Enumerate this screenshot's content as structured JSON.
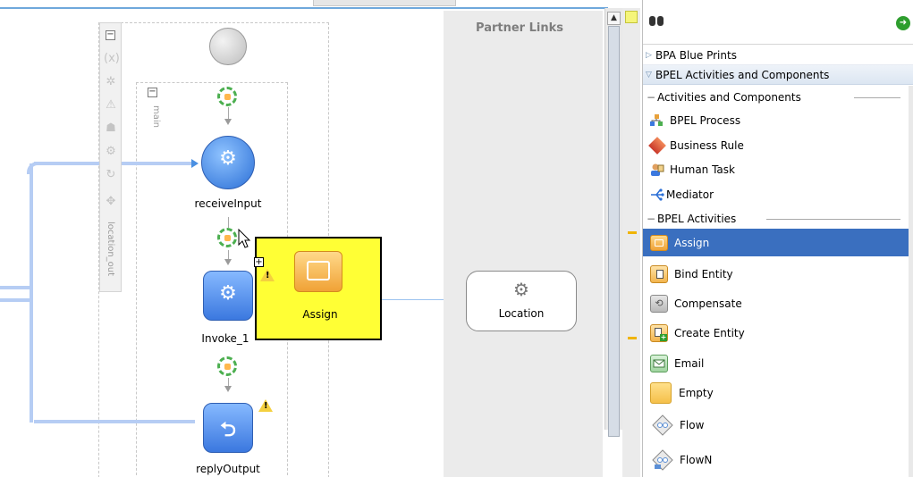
{
  "canvas": {
    "scope_label": "main",
    "variables_label": "location_out",
    "nodes": {
      "receive": "receiveInput",
      "invoke": "Invoke_1",
      "reply": "replyOutput"
    },
    "drag_preview_label": "Assign",
    "partner_links_title": "Partner Links",
    "partner_link_label": "Location"
  },
  "palette": {
    "search": {
      "value": "",
      "placeholder": ""
    },
    "categories": [
      {
        "label": "BPA Blue Prints",
        "expanded": false
      },
      {
        "label": "BPEL Activities and Components",
        "expanded": true
      }
    ],
    "sections": [
      {
        "title": "Activities and Components",
        "items": [
          {
            "label": "BPEL Process",
            "icon": "bpel-process-icon"
          },
          {
            "label": "Business Rule",
            "icon": "business-rule-icon"
          },
          {
            "label": "Human Task",
            "icon": "human-task-icon"
          },
          {
            "label": "Mediator",
            "icon": "mediator-icon"
          }
        ]
      },
      {
        "title": "BPEL Activities",
        "items": [
          {
            "label": "Assign",
            "icon": "assign-icon",
            "selected": true
          },
          {
            "label": "Bind Entity",
            "icon": "bind-entity-icon"
          },
          {
            "label": "Compensate",
            "icon": "compensate-icon"
          },
          {
            "label": "Create Entity",
            "icon": "create-entity-icon"
          },
          {
            "label": "Email",
            "icon": "email-icon"
          },
          {
            "label": "Empty",
            "icon": "empty-icon"
          },
          {
            "label": "Flow",
            "icon": "flow-icon"
          },
          {
            "label": "FlowN",
            "icon": "flown-icon"
          }
        ]
      }
    ]
  },
  "colors": {
    "selection": "#3a6fbf",
    "drag_highlight": "#ffff35",
    "node_blue": "#3b78df",
    "flow_line": "#b6cdf4",
    "warning": "#f4d03f"
  }
}
